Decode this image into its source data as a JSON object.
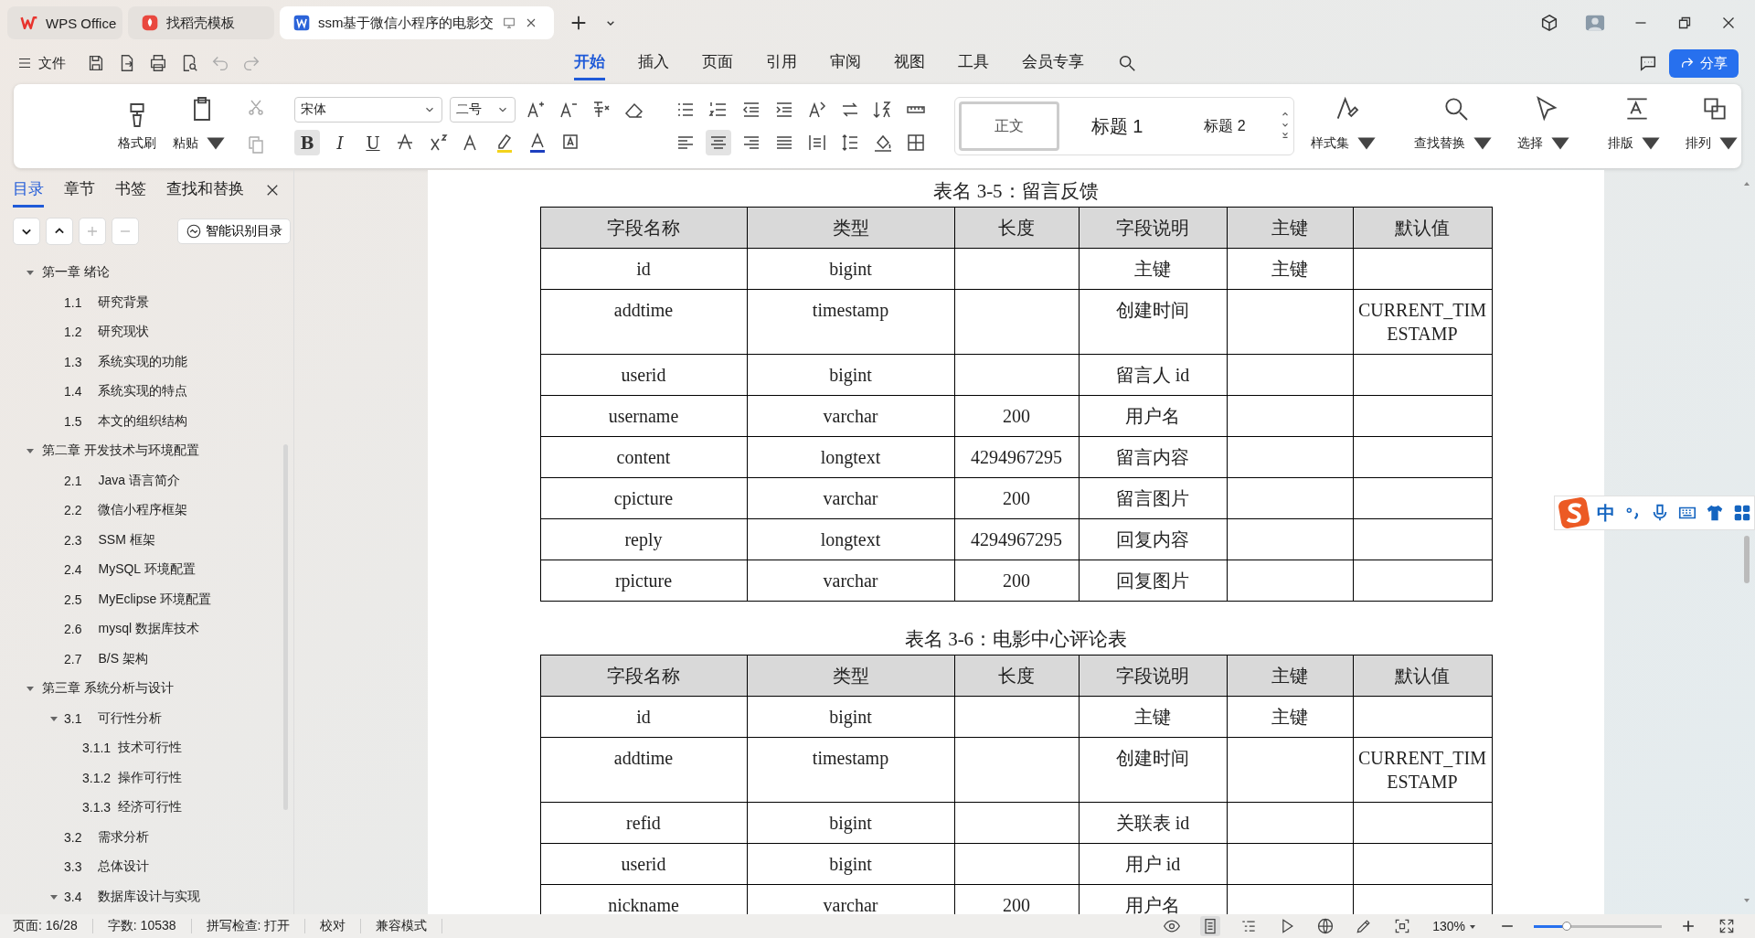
{
  "title_tabs": [
    {
      "label": "WPS Office",
      "kind": "home",
      "selected": false
    },
    {
      "label": "找稻壳模板",
      "kind": "template",
      "selected": false
    },
    {
      "label": "ssm基于微信小程序的电影交",
      "kind": "document",
      "selected": true
    }
  ],
  "menu": {
    "file": "文件",
    "items": [
      {
        "label": "开始",
        "selected": true
      },
      {
        "label": "插入",
        "selected": false
      },
      {
        "label": "页面",
        "selected": false
      },
      {
        "label": "引用",
        "selected": false
      },
      {
        "label": "审阅",
        "selected": false
      },
      {
        "label": "视图",
        "selected": false
      },
      {
        "label": "工具",
        "selected": false
      },
      {
        "label": "会员专享",
        "selected": false
      }
    ],
    "share": "分享"
  },
  "ribbon": {
    "format_painter": "格式刷",
    "paste": "粘贴",
    "font": "宋体",
    "size": "二号",
    "format_buttons": [
      {
        "label": "B",
        "selected": true
      },
      {
        "label": "I",
        "selected": false
      },
      {
        "label": "U",
        "selected": false
      }
    ],
    "styles": [
      {
        "label": "正文",
        "selected": true
      },
      {
        "label": "标题 1",
        "selected": false
      },
      {
        "label": "标题 2",
        "selected": false
      }
    ],
    "style_set": "样式集",
    "find_replace": "查找替换",
    "select": "选择",
    "layout": "排版",
    "arrange": "排列"
  },
  "sidebar": {
    "tabs": [
      {
        "label": "目录",
        "selected": true
      },
      {
        "label": "章节",
        "selected": false
      },
      {
        "label": "书签",
        "selected": false
      },
      {
        "label": "查找和替换",
        "selected": false
      }
    ],
    "smart_button": "智能识别目录",
    "outline": [
      {
        "title": "第一章  绪论",
        "expanded": true,
        "children": [
          {
            "num": "1.1",
            "title": "研究背景"
          },
          {
            "num": "1.2",
            "title": "研究现状"
          },
          {
            "num": "1.3",
            "title": "系统实现的功能"
          },
          {
            "num": "1.4",
            "title": "系统实现的特点"
          },
          {
            "num": "1.5",
            "title": "本文的组织结构"
          }
        ]
      },
      {
        "title": "第二章  开发技术与环境配置",
        "expanded": true,
        "children": [
          {
            "num": "2.1",
            "title": "Java 语言简介"
          },
          {
            "num": "2.2",
            "title": "微信小程序框架"
          },
          {
            "num": "2.3",
            "title": "SSM 框架"
          },
          {
            "num": "2.4",
            "title": "MySQL 环境配置"
          },
          {
            "num": "2.5",
            "title": "MyEclipse 环境配置"
          },
          {
            "num": "2.6",
            "title": "mysql 数据库技术"
          },
          {
            "num": "2.7",
            "title": "B/S 架构"
          }
        ]
      },
      {
        "title": "第三章  系统分析与设计",
        "expanded": true,
        "children": [
          {
            "num": "3.1",
            "title": "可行性分析",
            "expanded": true,
            "children": [
              {
                "num": "3.1.1",
                "title": "技术可行性"
              },
              {
                "num": "3.1.2",
                "title": "操作可行性"
              },
              {
                "num": "3.1.3",
                "title": "经济可行性"
              }
            ]
          },
          {
            "num": "3.2",
            "title": "需求分析"
          },
          {
            "num": "3.3",
            "title": "总体设计"
          },
          {
            "num": "3.4",
            "title": "数据库设计与实现",
            "expanded": true
          }
        ]
      }
    ]
  },
  "document": {
    "tables": [
      {
        "caption": "表名 3-5：留言反馈",
        "columns": [
          "字段名称",
          "类型",
          "长度",
          "字段说明",
          "主键",
          "默认值"
        ],
        "rows": [
          [
            "id",
            "bigint",
            "",
            "主键",
            "主键",
            ""
          ],
          [
            "addtime",
            "timestamp",
            "",
            "创建时间",
            "",
            "CURRENT_TIMESTAMP"
          ],
          [
            "userid",
            "bigint",
            "",
            "留言人 id",
            "",
            ""
          ],
          [
            "username",
            "varchar",
            "200",
            "用户名",
            "",
            ""
          ],
          [
            "content",
            "longtext",
            "4294967295",
            "留言内容",
            "",
            ""
          ],
          [
            "cpicture",
            "varchar",
            "200",
            "留言图片",
            "",
            ""
          ],
          [
            "reply",
            "longtext",
            "4294967295",
            "回复内容",
            "",
            ""
          ],
          [
            "rpicture",
            "varchar",
            "200",
            "回复图片",
            "",
            ""
          ]
        ]
      },
      {
        "caption": "表名 3-6：电影中心评论表",
        "columns": [
          "字段名称",
          "类型",
          "长度",
          "字段说明",
          "主键",
          "默认值"
        ],
        "rows": [
          [
            "id",
            "bigint",
            "",
            "主键",
            "主键",
            ""
          ],
          [
            "addtime",
            "timestamp",
            "",
            "创建时间",
            "",
            "CURRENT_TIMESTAMP"
          ],
          [
            "refid",
            "bigint",
            "",
            "关联表 id",
            "",
            ""
          ],
          [
            "userid",
            "bigint",
            "",
            "用户 id",
            "",
            ""
          ],
          [
            "nickname",
            "varchar",
            "200",
            "用户名",
            "",
            ""
          ]
        ]
      }
    ]
  },
  "ime": {
    "mode": "中"
  },
  "status_bar": {
    "items": [
      "页面: 16/28",
      "字数: 10538",
      "拼写检查: 打开",
      "校对",
      "兼容模式"
    ],
    "zoom": "130%",
    "zoom_slider": {
      "level": 0.26
    }
  }
}
